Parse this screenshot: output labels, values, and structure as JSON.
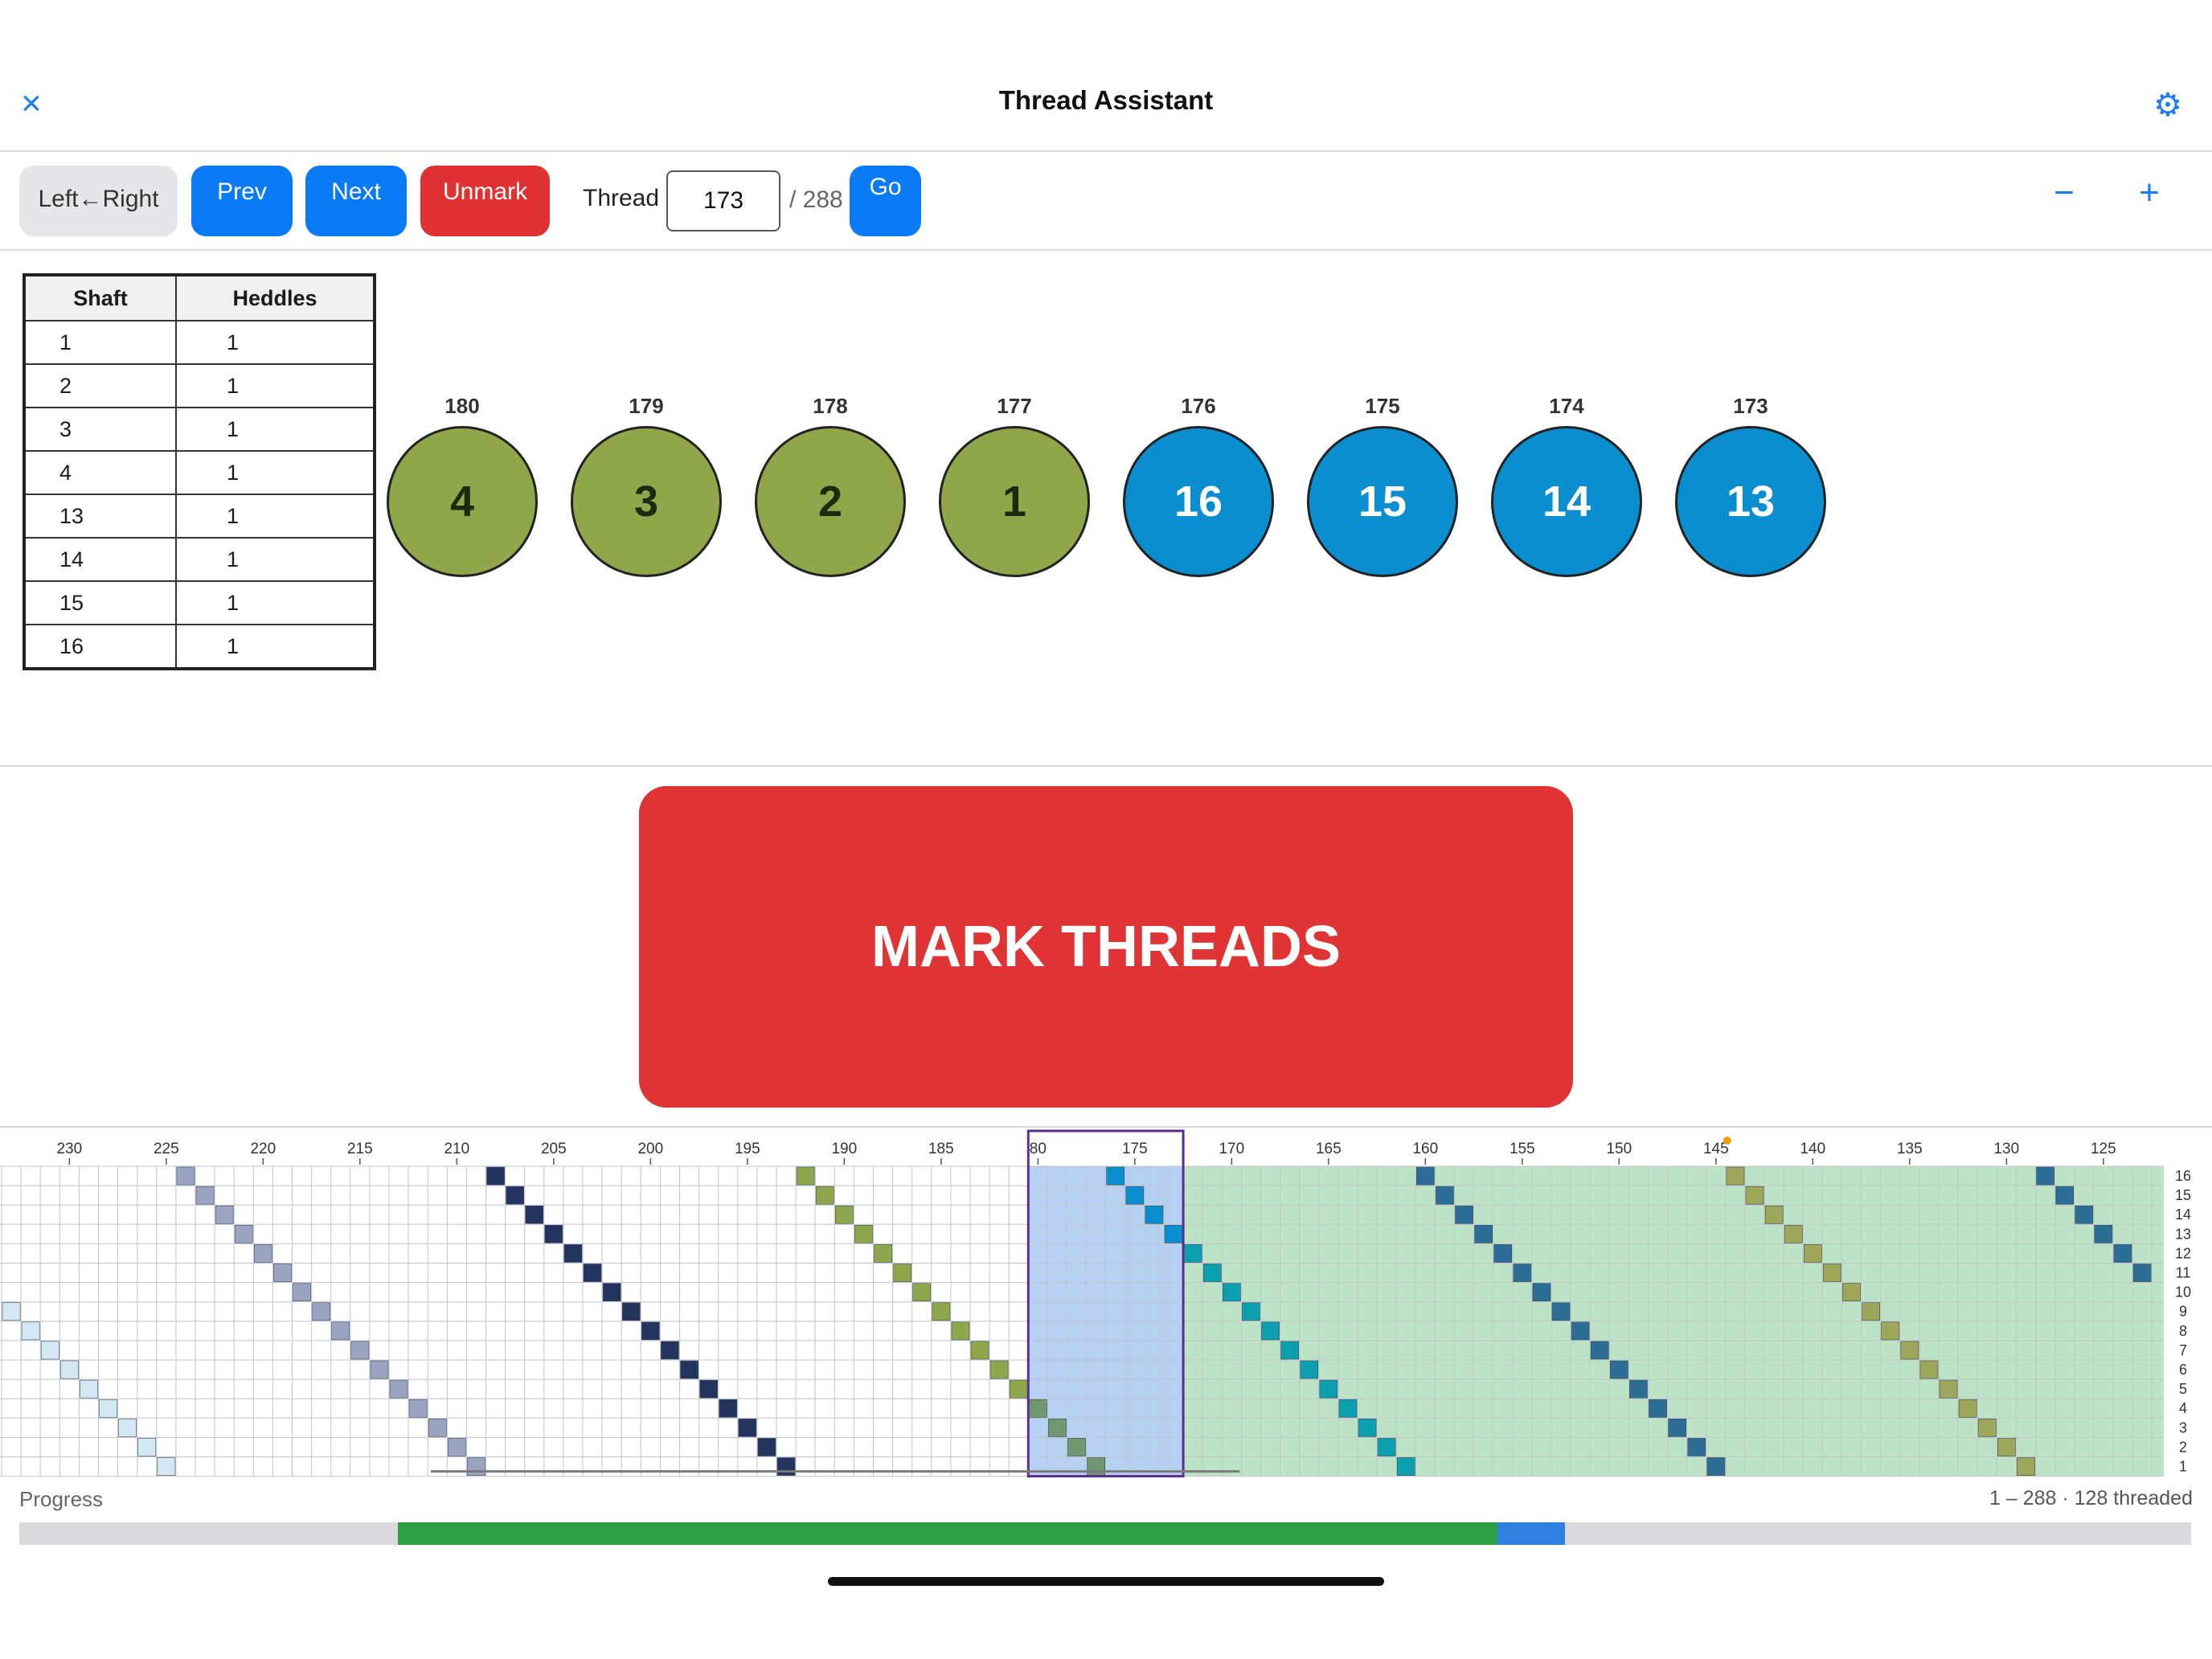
{
  "header": {
    "title": "Thread Assistant",
    "close_icon": "×",
    "settings_icon": "⚙"
  },
  "toolbar": {
    "direction_label": "Left←Right",
    "prev_label": "Prev",
    "next_label": "Next",
    "unmark_label": "Unmark",
    "thread_label": "Thread",
    "thread_value": "173",
    "thread_total": "/ 288",
    "go_label": "Go",
    "zoom_out_icon": "−",
    "zoom_in_icon": "+"
  },
  "shaft_table": {
    "headers": [
      "Shaft",
      "Heddles"
    ],
    "rows": [
      [
        "1",
        "1"
      ],
      [
        "2",
        "1"
      ],
      [
        "3",
        "1"
      ],
      [
        "4",
        "1"
      ],
      [
        "13",
        "1"
      ],
      [
        "14",
        "1"
      ],
      [
        "15",
        "1"
      ],
      [
        "16",
        "1"
      ]
    ]
  },
  "threads": [
    {
      "number": "180",
      "shaft": "4",
      "color": "green"
    },
    {
      "number": "179",
      "shaft": "3",
      "color": "green"
    },
    {
      "number": "178",
      "shaft": "2",
      "color": "green"
    },
    {
      "number": "177",
      "shaft": "1",
      "color": "green"
    },
    {
      "number": "176",
      "shaft": "16",
      "color": "blue"
    },
    {
      "number": "175",
      "shaft": "15",
      "color": "blue"
    },
    {
      "number": "174",
      "shaft": "14",
      "color": "blue"
    },
    {
      "number": "173",
      "shaft": "13",
      "color": "blue"
    }
  ],
  "mark_button": "MARK THREADS",
  "draft": {
    "visible_thread_start": 233,
    "visible_thread_end": 121,
    "shafts": 16,
    "ruler_labels": [
      "230",
      "225",
      "220",
      "215",
      "210",
      "205",
      "200",
      "195",
      "190",
      "185",
      "80",
      "175",
      "170",
      "165",
      "160",
      "155",
      "150",
      "145",
      "140",
      "135",
      "130",
      "125"
    ],
    "ruler_values": [
      230,
      225,
      220,
      215,
      210,
      205,
      200,
      195,
      190,
      185,
      180,
      175,
      170,
      165,
      160,
      155,
      150,
      145,
      140,
      135,
      130,
      125
    ],
    "shaft_labels": [
      "16",
      "15",
      "14",
      "13",
      "12",
      "11",
      "10",
      "9",
      "8",
      "7",
      "6",
      "5",
      "4",
      "3",
      "2",
      "1"
    ],
    "current_window": [
      173,
      180
    ],
    "threaded_range": [
      1,
      172
    ],
    "marker_thread": 144,
    "colors": {
      "light_blue": "#d3e8f3",
      "lavender": "#9aa3c0",
      "navy": "#25335f",
      "olive": "#8fa64a",
      "teal": "#0c9fb0",
      "steel": "#2d6e96",
      "gold": "#9ea65a",
      "blue_cell": "#0b8ecf",
      "selection_fill": "#b6d0f2",
      "selection_border": "#5b2d91",
      "threaded_fill": "#bde3c6",
      "marker": "#f0a000"
    }
  },
  "progress": {
    "label": "Progress",
    "info": "1 – 288 · 128 threaded",
    "total": 288,
    "threaded_fraction": [
      0.1744,
      0.6806
    ],
    "current_fraction": [
      0.6806,
      0.7118
    ],
    "threaded_color": "#2ea043",
    "current_color": "#2f7fe0"
  }
}
